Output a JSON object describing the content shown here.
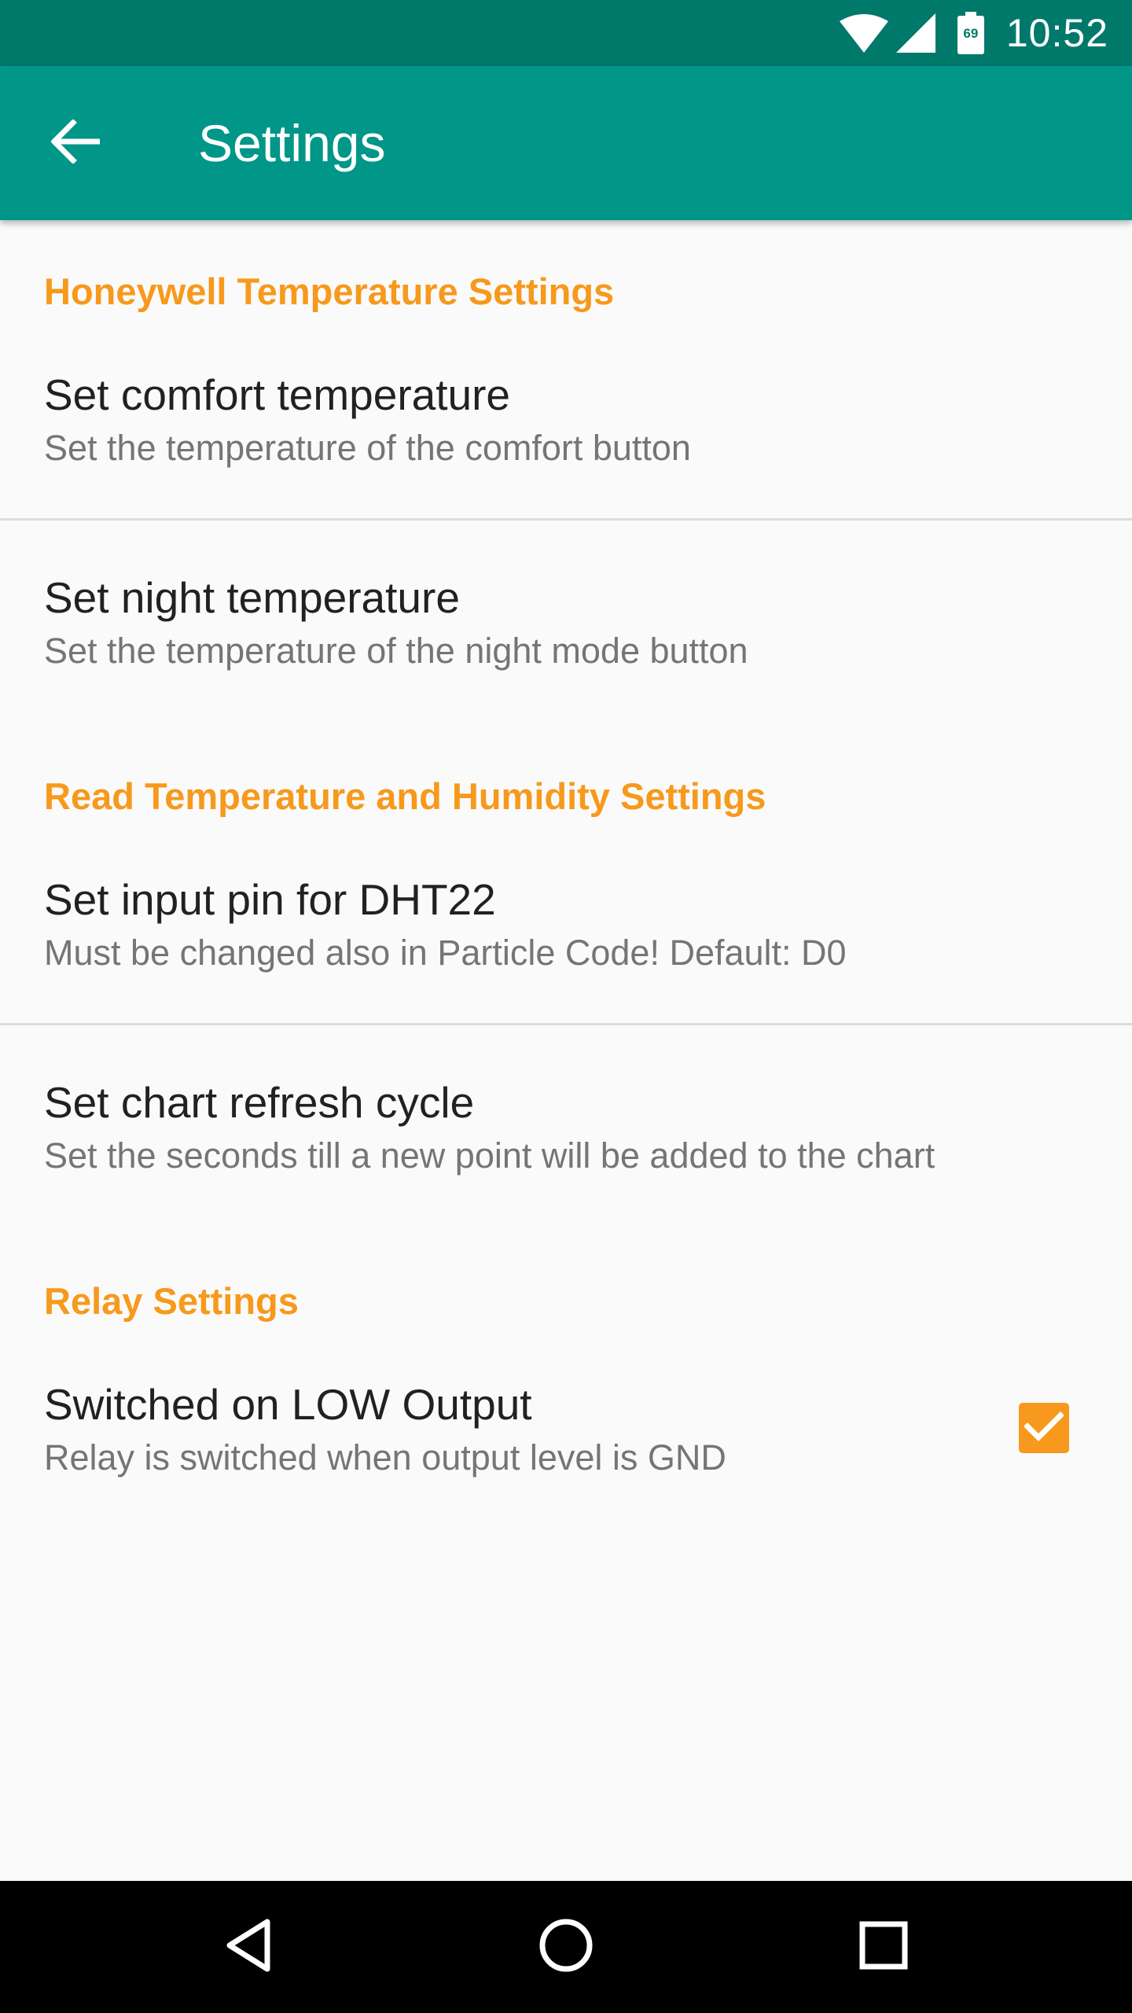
{
  "status_bar": {
    "time": "10:52",
    "icons": [
      "wifi-icon",
      "cell-signal-icon",
      "battery-icon"
    ],
    "battery_level": "69"
  },
  "app_bar": {
    "title": "Settings",
    "back_icon": "arrow-back-icon"
  },
  "categories": [
    {
      "title": "Honeywell Temperature Settings",
      "prefs": [
        {
          "title": "Set comfort temperature",
          "summary": "Set the temperature of the comfort button"
        },
        {
          "title": "Set night temperature",
          "summary": "Set the temperature of the night mode button"
        }
      ]
    },
    {
      "title": "Read Temperature and Humidity Settings",
      "prefs": [
        {
          "title": "Set input pin for DHT22",
          "summary": "Must be changed also in Particle Code! Default: D0"
        },
        {
          "title": "Set chart refresh cycle",
          "summary": "Set the seconds till a new point will be added to the chart"
        }
      ]
    },
    {
      "title": "Relay Settings",
      "prefs": [
        {
          "title": "Switched on LOW Output",
          "summary": "Relay is switched when output level is GND",
          "checked": true
        }
      ]
    }
  ],
  "nav_bar": {
    "icons": [
      "back-triangle-icon",
      "home-circle-icon",
      "recents-square-icon"
    ]
  },
  "colors": {
    "status_bar": "#00796b",
    "app_bar": "#009688",
    "accent": "#f7991c",
    "background": "#fafafa"
  }
}
